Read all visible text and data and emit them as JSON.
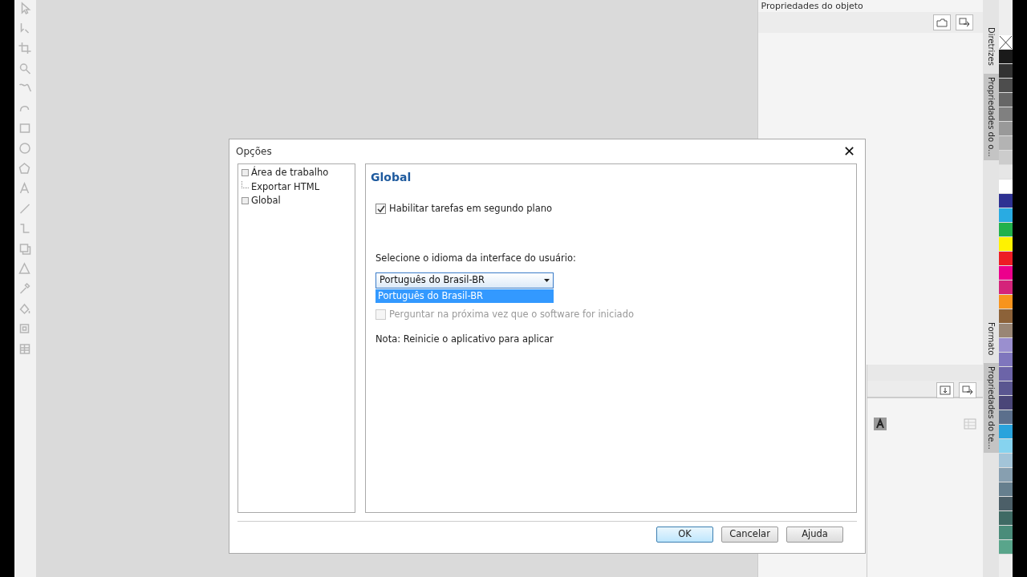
{
  "docker": {
    "title": "Propriedades do objeto"
  },
  "side_tabs": [
    {
      "label": "Diretrizes",
      "selected": false
    },
    {
      "label": "Propriedades do o...",
      "selected": true
    },
    {
      "label": "Formato",
      "selected": false
    },
    {
      "label": "Propriedades do te...",
      "selected": true
    }
  ],
  "palette": [
    {
      "kind": "none"
    },
    {
      "kind": "color",
      "color": "#1a1a1a"
    },
    {
      "kind": "color",
      "color": "#333333"
    },
    {
      "kind": "color",
      "color": "#4d4d4d"
    },
    {
      "kind": "color",
      "color": "#666666"
    },
    {
      "kind": "color",
      "color": "#808080"
    },
    {
      "kind": "color",
      "color": "#999999"
    },
    {
      "kind": "color",
      "color": "#b3b3b3"
    },
    {
      "kind": "color",
      "color": "#cccccc"
    },
    {
      "kind": "color",
      "color": "#e6e6e6"
    },
    {
      "kind": "color",
      "color": "#ffffff"
    },
    {
      "kind": "color",
      "color": "#2e3192"
    },
    {
      "kind": "color",
      "color": "#29abe2"
    },
    {
      "kind": "color",
      "color": "#22b14c"
    },
    {
      "kind": "color",
      "color": "#fff200"
    },
    {
      "kind": "color",
      "color": "#ed1c24"
    },
    {
      "kind": "color",
      "color": "#ec008c"
    },
    {
      "kind": "color",
      "color": "#d4237a"
    },
    {
      "kind": "color",
      "color": "#f7941d"
    },
    {
      "kind": "color",
      "color": "#8c6239"
    },
    {
      "kind": "color",
      "color": "#998675"
    },
    {
      "kind": "color",
      "color": "#9a8fcf"
    },
    {
      "kind": "color",
      "color": "#7f76bd"
    },
    {
      "kind": "color",
      "color": "#6c64a8"
    },
    {
      "kind": "color",
      "color": "#5a5690"
    },
    {
      "kind": "color",
      "color": "#4a4678"
    },
    {
      "kind": "color",
      "color": "#5b6f8c"
    },
    {
      "kind": "color",
      "color": "#29a3dc"
    },
    {
      "kind": "color",
      "color": "#86d3ef"
    },
    {
      "kind": "color",
      "color": "#a3c4d8"
    },
    {
      "kind": "color",
      "color": "#879fb0"
    },
    {
      "kind": "color",
      "color": "#667f8e"
    },
    {
      "kind": "color",
      "color": "#4c5f68"
    },
    {
      "kind": "color",
      "color": "#3f6a64"
    },
    {
      "kind": "color",
      "color": "#4a8c7a"
    },
    {
      "kind": "color",
      "color": "#59a58b"
    }
  ],
  "dialog": {
    "title": "Opções",
    "close": "✕",
    "tree": [
      {
        "label": "Área de trabalho",
        "has_children": true
      },
      {
        "label": "Exportar HTML",
        "has_children": false
      },
      {
        "label": "Global",
        "has_children": true
      }
    ],
    "heading": "Global",
    "background_tasks": {
      "label": "Habilitar tarefas em segundo plano",
      "checked": true
    },
    "language_label": "Selecione o idioma da interface do usuário:",
    "language_select": {
      "value": "Português do Brasil-BR",
      "open": true,
      "options": [
        {
          "label": "Português do Brasil-BR",
          "selected": true
        }
      ]
    },
    "ask_next_time": {
      "label": "Perguntar na próxima vez que o software for iniciado",
      "checked": false,
      "disabled": true
    },
    "note": "Nota: Reinicie o aplicativo para aplicar",
    "buttons": [
      {
        "label": "OK",
        "default": true
      },
      {
        "label": "Cancelar",
        "default": false
      },
      {
        "label": "Ajuda",
        "default": false
      }
    ]
  }
}
